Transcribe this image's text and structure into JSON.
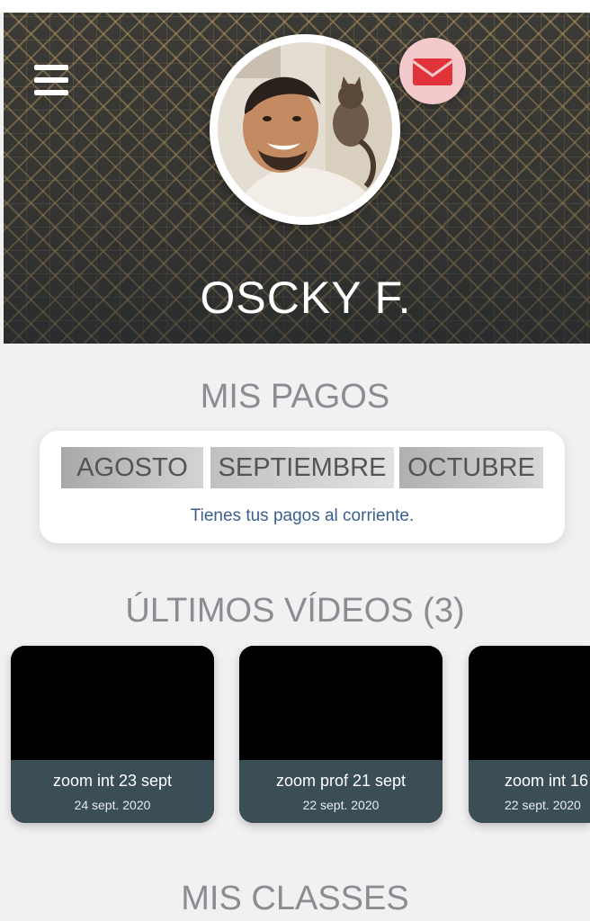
{
  "profile": {
    "name": "OSCKY F."
  },
  "payments": {
    "title": "MIS PAGOS",
    "months": [
      "AGOSTO",
      "SEPTIEMBRE",
      "OCTUBRE"
    ],
    "status": "Tienes tus pagos al corriente."
  },
  "videos": {
    "title": "ÚLTIMOS VÍDEOS (3)",
    "items": [
      {
        "title": "zoom int 23 sept",
        "date": "24 sept. 2020"
      },
      {
        "title": "zoom prof 21 sept",
        "date": "22 sept. 2020"
      },
      {
        "title": "zoom int 16",
        "date": "22 sept. 2020"
      }
    ]
  },
  "classes": {
    "title": "MIS CLASSES"
  },
  "icons": {
    "menu": "hamburger-menu-icon",
    "messages": "envelope-icon"
  },
  "colors": {
    "accent_red": "#e0333a",
    "card_footer": "#3b4d55",
    "status_text": "#3b5f8c"
  }
}
